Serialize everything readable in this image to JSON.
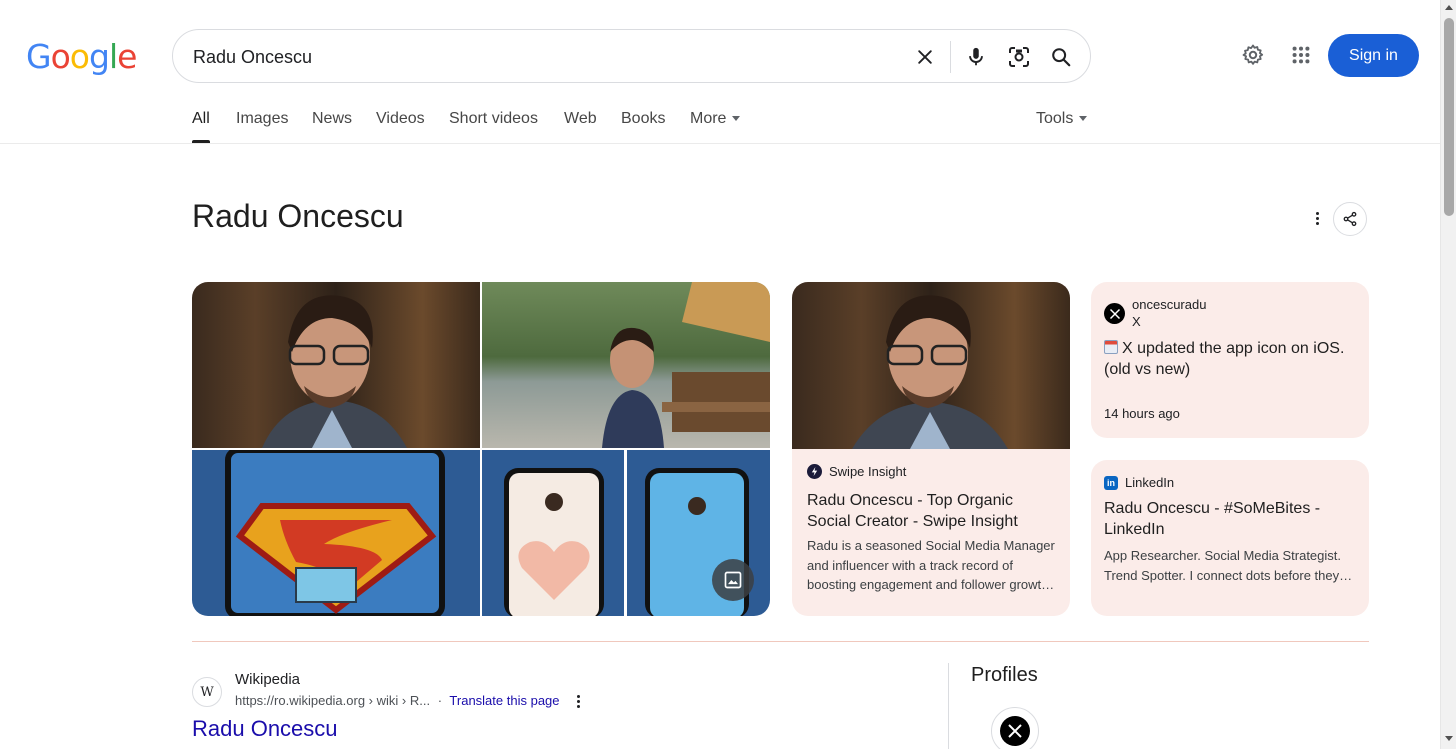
{
  "logo": {
    "letters": [
      "G",
      "o",
      "o",
      "g",
      "l",
      "e"
    ],
    "colors": [
      "#4285f4",
      "#ea4335",
      "#fbbc05",
      "#4285f4",
      "#34a853",
      "#ea4335"
    ]
  },
  "search": {
    "query": "Radu Oncescu",
    "icons": [
      "clear-icon",
      "microphone-icon",
      "lens-icon",
      "search-icon"
    ]
  },
  "header": {
    "settings_icon": "gear-icon",
    "apps_icon": "apps-grid-icon",
    "signin_label": "Sign in"
  },
  "tabs": [
    {
      "label": "All",
      "active": true
    },
    {
      "label": "Images"
    },
    {
      "label": "News"
    },
    {
      "label": "Videos"
    },
    {
      "label": "Short videos"
    },
    {
      "label": "Web"
    },
    {
      "label": "Books"
    },
    {
      "label": "More"
    }
  ],
  "tools_label": "Tools",
  "knowledge_panel": {
    "title": "Radu Oncescu",
    "card_swipe": {
      "source": "Swipe Insight",
      "title": "Radu Oncescu - Top Organic Social Creator - Swipe Insight",
      "snippet": "Radu is a seasoned Social Media Manager and influencer with a track record of boosting engagement and follower growt…"
    },
    "card_x": {
      "account": "oncescuradu",
      "platform": "X",
      "post": "X updated the app icon on iOS. (old vs new)",
      "time": "14 hours ago"
    },
    "card_linkedin": {
      "source": "LinkedIn",
      "title": "Radu Oncescu - #SoMeBites - LinkedIn",
      "snippet": "App Researcher. Social Media Strategist. Trend Spotter. I connect dots before they…"
    }
  },
  "result": {
    "site": "Wikipedia",
    "favicon_letter": "W",
    "url": "https://ro.wikipedia.org › wiki › R...",
    "separator": "·",
    "translate": "Translate this page",
    "title": "Radu Oncescu"
  },
  "profiles": {
    "heading": "Profiles"
  }
}
